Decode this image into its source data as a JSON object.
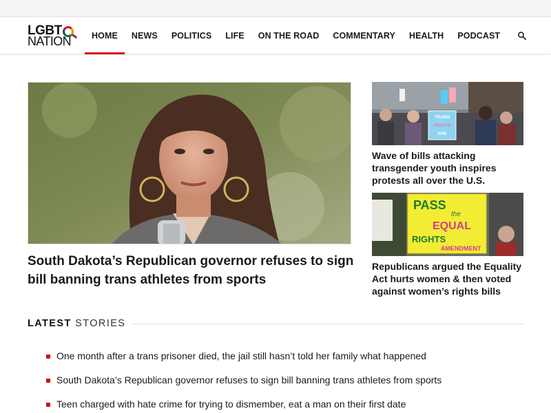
{
  "site": {
    "logo_line1": "LGBT",
    "logo_line2": "NATION"
  },
  "nav": {
    "items": [
      "HOME",
      "NEWS",
      "POLITICS",
      "LIFE",
      "ON THE ROAD",
      "COMMENTARY",
      "HEALTH",
      "PODCAST"
    ],
    "active": "HOME"
  },
  "icons": {
    "search": "search-icon"
  },
  "colors": {
    "accent": "#d10a11",
    "text": "#1a1a1a"
  },
  "hero": {
    "title": "South Dakota’s Republican governor refuses to sign bill banning trans athletes from sports"
  },
  "sidebar": {
    "cards": [
      {
        "title": "Wave of bills attacking transgender youth inspires protests all over the U.S.",
        "sign_text": [
          "TRANS",
          "RIGHTS",
          "ARE"
        ]
      },
      {
        "title": "Republicans argued the Equality Act hurts women & then voted against women’s rights bills",
        "sign_text": [
          "PASS",
          "the",
          "EQUAL",
          "RIGHTS",
          "AMENDMENT"
        ]
      }
    ]
  },
  "latest": {
    "heading_bold": "LATEST",
    "heading_light": "STORIES",
    "stories": [
      "One month after a trans prisoner died, the jail still hasn’t told her family what happened",
      "South Dakota’s Republican governor refuses to sign bill banning trans athletes from sports",
      "Teen charged with hate crime for trying to dismember, eat a man on their first date"
    ]
  }
}
